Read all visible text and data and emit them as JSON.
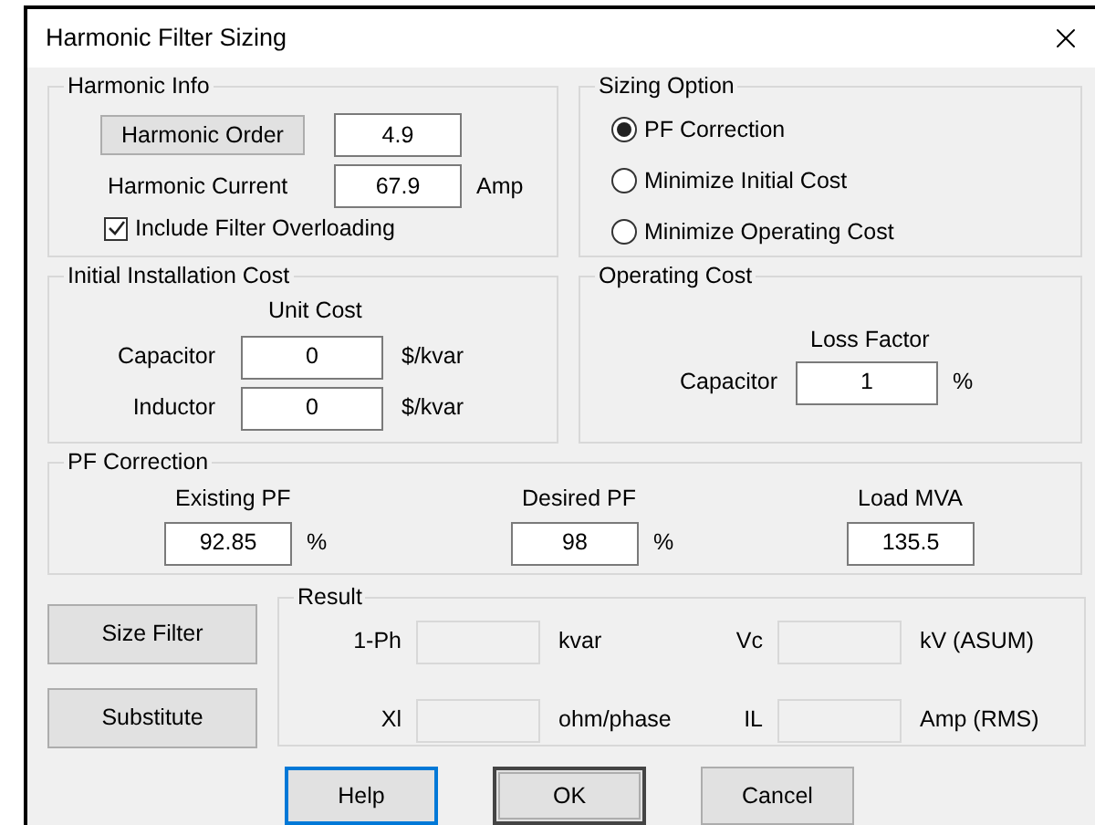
{
  "window": {
    "title": "Harmonic Filter Sizing"
  },
  "harmonic_info": {
    "title": "Harmonic Info",
    "order_button": "Harmonic Order",
    "order_value": "4.9",
    "current_label": "Harmonic Current",
    "current_value": "67.9",
    "current_unit": "Amp",
    "overloading": {
      "label": "Include Filter Overloading",
      "checked": true
    }
  },
  "sizing_option": {
    "title": "Sizing Option",
    "options": [
      {
        "label": "PF Correction",
        "selected": true
      },
      {
        "label": "Minimize Initial Cost",
        "selected": false
      },
      {
        "label": "Minimize Operating Cost",
        "selected": false
      }
    ]
  },
  "initial_cost": {
    "title": "Initial Installation Cost",
    "column_heading": "Unit Cost",
    "rows": [
      {
        "label": "Capacitor",
        "value": "0",
        "unit": "$/kvar"
      },
      {
        "label": "Inductor",
        "value": "0",
        "unit": "$/kvar"
      }
    ]
  },
  "operating_cost": {
    "title": "Operating Cost",
    "column_heading": "Loss Factor",
    "label": "Capacitor",
    "value": "1",
    "unit": "%"
  },
  "pf_correction": {
    "title": "PF Correction",
    "fields": [
      {
        "label": "Existing PF",
        "value": "92.85",
        "unit": "%"
      },
      {
        "label": "Desired PF",
        "value": "98",
        "unit": "%"
      },
      {
        "label": "Load MVA",
        "value": "135.5"
      }
    ]
  },
  "side_buttons": [
    "Size Filter",
    "Substitute"
  ],
  "result": {
    "title": "Result",
    "fields": [
      {
        "label": "1-Ph",
        "unit": "kvar"
      },
      {
        "label": "Vc",
        "unit": "kV (ASUM)"
      },
      {
        "label": "Xl",
        "unit": "ohm/phase"
      },
      {
        "label": "IL",
        "unit": "Amp (RMS)"
      }
    ]
  },
  "buttons": [
    {
      "label": "Help",
      "kind": "focused"
    },
    {
      "label": "OK",
      "kind": "default"
    },
    {
      "label": "Cancel",
      "kind": "normal"
    }
  ]
}
